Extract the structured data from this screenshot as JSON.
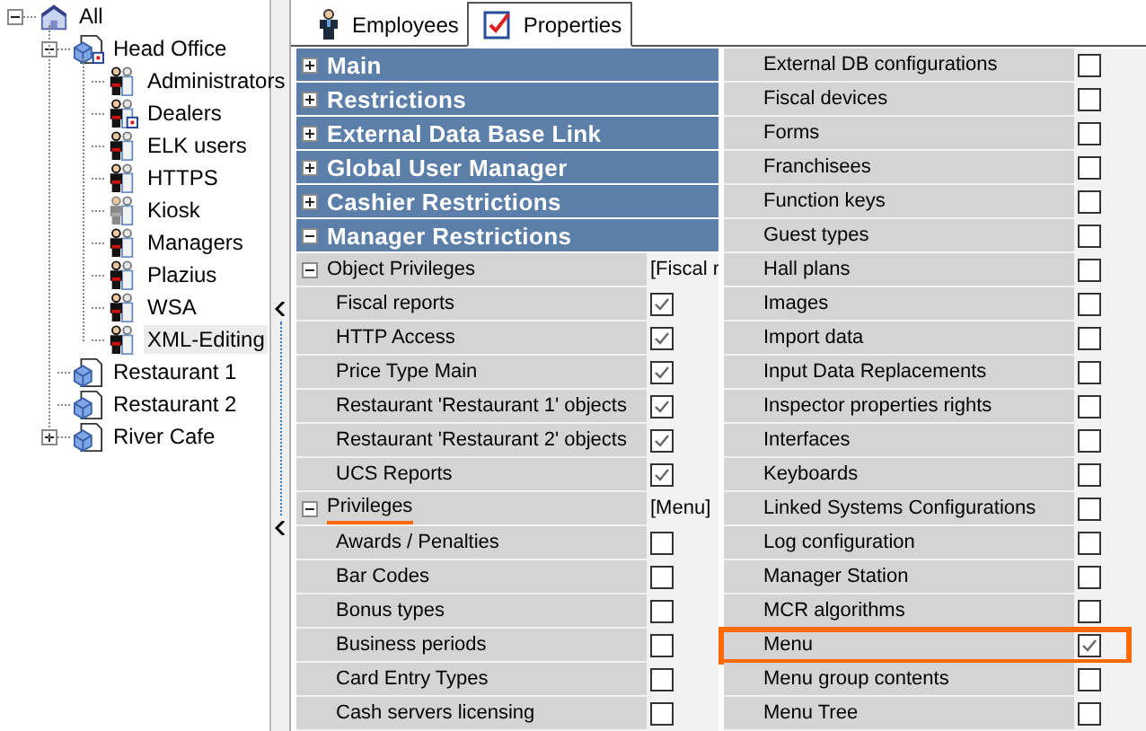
{
  "tree": [
    {
      "label": "All",
      "kind": "root",
      "expanded": true,
      "selected": false,
      "flagged": false,
      "children": [
        {
          "label": "Head Office",
          "kind": "office",
          "expanded": true,
          "selected": false,
          "flagged": true,
          "children": [
            {
              "label": "Administrators",
              "kind": "group",
              "selected": false,
              "flagged": false,
              "disabled": false
            },
            {
              "label": "Dealers",
              "kind": "group",
              "selected": false,
              "flagged": true,
              "disabled": false
            },
            {
              "label": "ELK users",
              "kind": "group",
              "selected": false,
              "flagged": false,
              "disabled": false
            },
            {
              "label": "HTTPS",
              "kind": "group",
              "selected": false,
              "flagged": false,
              "disabled": false
            },
            {
              "label": "Kiosk",
              "kind": "group",
              "selected": false,
              "flagged": false,
              "disabled": true
            },
            {
              "label": "Managers",
              "kind": "group",
              "selected": false,
              "flagged": false,
              "disabled": false
            },
            {
              "label": "Plazius",
              "kind": "group",
              "selected": false,
              "flagged": false,
              "disabled": false
            },
            {
              "label": "WSA",
              "kind": "group",
              "selected": false,
              "flagged": false,
              "disabled": false
            },
            {
              "label": "XML-Editing",
              "kind": "group",
              "selected": true,
              "flagged": false,
              "disabled": false
            }
          ]
        },
        {
          "label": "Restaurant 1",
          "kind": "office",
          "selected": false,
          "flagged": false
        },
        {
          "label": "Restaurant 2",
          "kind": "office",
          "selected": false,
          "flagged": false
        },
        {
          "label": "River Cafe",
          "kind": "office",
          "expanded": false,
          "selected": false,
          "flagged": false
        }
      ]
    }
  ],
  "tabs": [
    {
      "label": "Employees",
      "kind": "person",
      "selected": false
    },
    {
      "label": "Properties",
      "kind": "checklist",
      "selected": true
    }
  ],
  "sections": [
    {
      "title": "Main",
      "expanded": false
    },
    {
      "title": "Restrictions",
      "expanded": false
    },
    {
      "title": "External Data Base Link",
      "expanded": false
    },
    {
      "title": "Global User Manager",
      "expanded": false
    },
    {
      "title": "Cashier Restrictions",
      "expanded": false
    },
    {
      "title": "Manager Restrictions",
      "expanded": true,
      "groups": [
        {
          "title": "Object Privileges",
          "value": "[Fiscal r",
          "expanded": true,
          "underlined": false,
          "items": [
            {
              "label": "Fiscal reports",
              "checked": true
            },
            {
              "label": "HTTP Access",
              "checked": true
            },
            {
              "label": "Price Type Main",
              "checked": true
            },
            {
              "label": "Restaurant 'Restaurant 1' objects",
              "checked": true
            },
            {
              "label": "Restaurant 'Restaurant 2' objects",
              "checked": true
            },
            {
              "label": "UCS Reports",
              "checked": true
            }
          ]
        },
        {
          "title": "Privileges",
          "value": "[Menu]",
          "expanded": true,
          "underlined": true,
          "items": [
            {
              "label": "Awards / Penalties",
              "checked": false
            },
            {
              "label": "Bar Codes",
              "checked": false
            },
            {
              "label": "Bonus types",
              "checked": false
            },
            {
              "label": "Business periods",
              "checked": false
            },
            {
              "label": "Card Entry Types",
              "checked": false
            },
            {
              "label": "Cash servers licensing",
              "checked": false
            }
          ]
        }
      ]
    }
  ],
  "right_rows": [
    {
      "label": "External DB configurations",
      "checked": false,
      "highlighted": false
    },
    {
      "label": "Fiscal devices",
      "checked": false,
      "highlighted": false
    },
    {
      "label": "Forms",
      "checked": false,
      "highlighted": false
    },
    {
      "label": "Franchisees",
      "checked": false,
      "highlighted": false
    },
    {
      "label": "Function keys",
      "checked": false,
      "highlighted": false
    },
    {
      "label": "Guest types",
      "checked": false,
      "highlighted": false
    },
    {
      "label": "Hall plans",
      "checked": false,
      "highlighted": false
    },
    {
      "label": "Images",
      "checked": false,
      "highlighted": false
    },
    {
      "label": "Import data",
      "checked": false,
      "highlighted": false
    },
    {
      "label": "Input Data Replacements",
      "checked": false,
      "highlighted": false
    },
    {
      "label": "Inspector properties rights",
      "checked": false,
      "highlighted": false
    },
    {
      "label": "Interfaces",
      "checked": false,
      "highlighted": false
    },
    {
      "label": "Keyboards",
      "checked": false,
      "highlighted": false
    },
    {
      "label": "Linked Systems Configurations",
      "checked": false,
      "highlighted": false
    },
    {
      "label": "Log configuration",
      "checked": false,
      "highlighted": false
    },
    {
      "label": "Manager Station",
      "checked": false,
      "highlighted": false
    },
    {
      "label": "MCR algorithms",
      "checked": false,
      "highlighted": false
    },
    {
      "label": "Menu",
      "checked": true,
      "highlighted": true
    },
    {
      "label": "Menu group contents",
      "checked": false,
      "highlighted": false
    },
    {
      "label": "Menu Tree",
      "checked": false,
      "highlighted": false
    }
  ]
}
